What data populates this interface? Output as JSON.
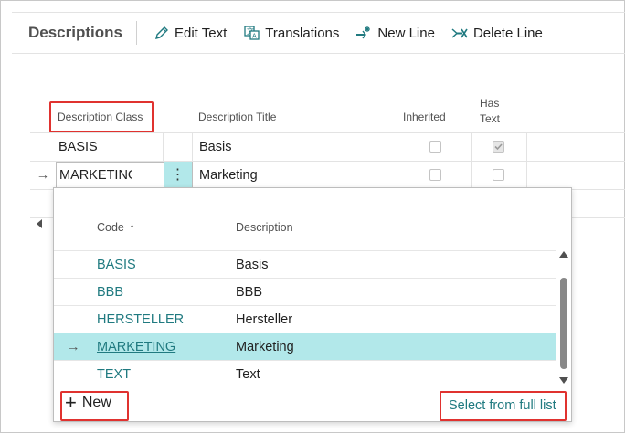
{
  "page": {
    "title": "Descriptions"
  },
  "actions": [
    {
      "label": "Edit Text",
      "icon": "pencil-icon"
    },
    {
      "label": "Translations",
      "icon": "translate-icon"
    },
    {
      "label": "New Line",
      "icon": "new-line-icon"
    },
    {
      "label": "Delete Line",
      "icon": "delete-line-icon"
    }
  ],
  "grid": {
    "columns": {
      "class": "Description Class",
      "title": "Description Title",
      "inherited": "Inherited",
      "has_text_1": "Has",
      "has_text_2": "Text"
    },
    "rows": [
      {
        "class": "BASIS",
        "title": "Basis",
        "inherited": false,
        "has_text": true
      },
      {
        "class": "MARKETING",
        "title": "Marketing",
        "inherited": false,
        "has_text": false,
        "current": true
      }
    ],
    "current_marker": "→",
    "more_glyph": "⋮"
  },
  "lookup": {
    "header_code": "Code",
    "sort_glyph": "↑",
    "header_description": "Description",
    "rows": [
      {
        "code": "BASIS",
        "description": "Basis"
      },
      {
        "code": "BBB",
        "description": "BBB"
      },
      {
        "code": "HERSTELLER",
        "description": "Hersteller"
      },
      {
        "code": "MARKETING",
        "description": "Marketing",
        "selected": true
      },
      {
        "code": "TEXT",
        "description": "Text"
      }
    ],
    "selected_marker": "→",
    "new_label": "New",
    "new_glyph": "+",
    "full_list_label": "Select from full list"
  },
  "colors": {
    "accent": "#207a80",
    "selection": "#b2e8ea",
    "highlight_box": "#e0322f"
  }
}
